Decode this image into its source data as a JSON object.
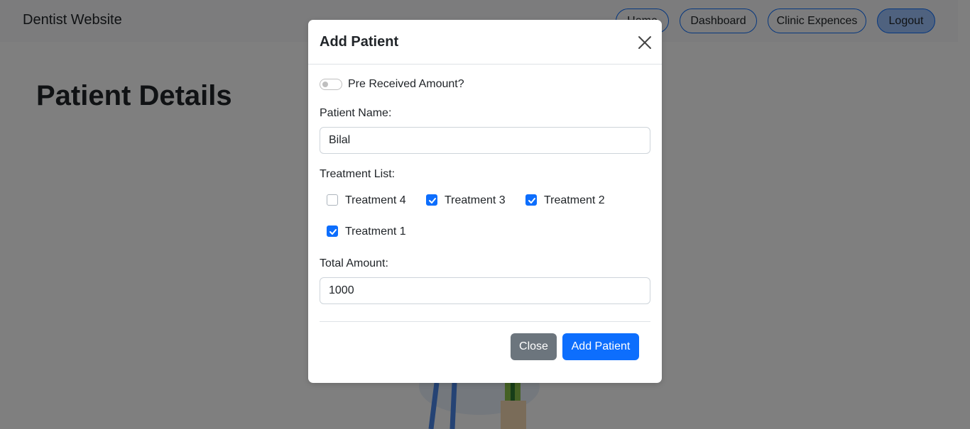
{
  "navbar": {
    "brand": "Dentist Website",
    "links": [
      "Home",
      "Dashboard",
      "Clinic Expences",
      "Logout"
    ]
  },
  "page": {
    "title": "Patient Details"
  },
  "modal": {
    "title": "Add Patient",
    "toggle": {
      "label": "Pre Received Amount?",
      "checked": false
    },
    "patient_name": {
      "label": "Patient Name:",
      "value": "Bilal"
    },
    "treatment_list": {
      "label": "Treatment List:",
      "items": [
        {
          "label": "Treatment 4",
          "checked": false
        },
        {
          "label": "Treatment 3",
          "checked": true
        },
        {
          "label": "Treatment 2",
          "checked": true
        },
        {
          "label": "Treatment 1",
          "checked": true
        }
      ]
    },
    "total_amount": {
      "label": "Total Amount:",
      "value": "1000"
    },
    "buttons": {
      "close": "Close",
      "add": "Add Patient"
    }
  },
  "colors": {
    "primary": "#0d6efd",
    "secondary": "#6c757d",
    "backdrop": "rgba(0,0,0,0.5)"
  }
}
